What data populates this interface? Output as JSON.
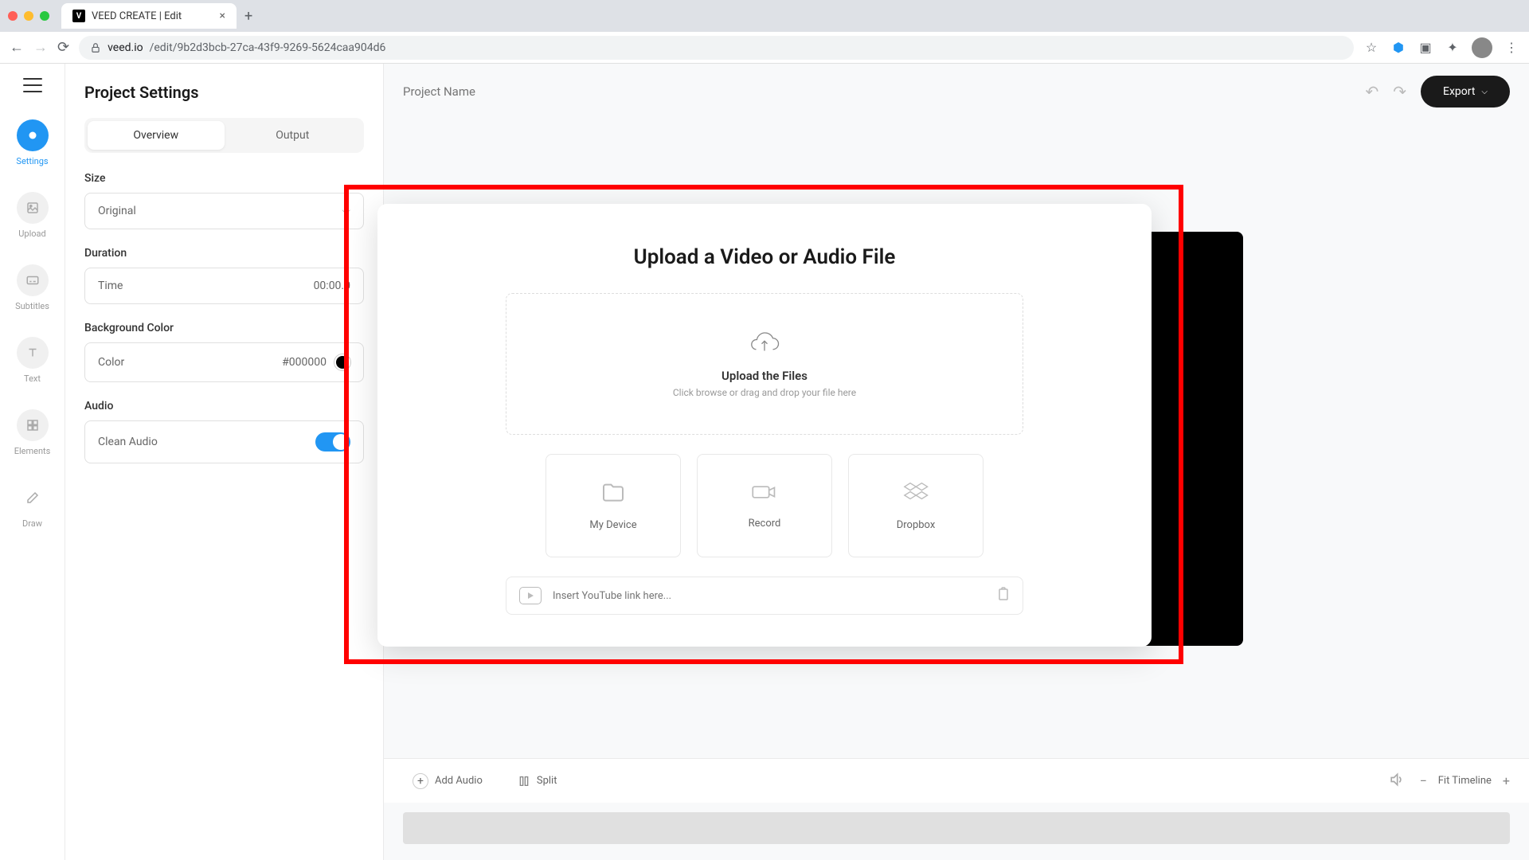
{
  "browser": {
    "tab_title": "VEED CREATE | Edit",
    "tab_favicon": "V",
    "url_domain": "veed.io",
    "url_path": "/edit/9b2d3bcb-27ca-43f9-9269-5624caa904d6"
  },
  "nav": {
    "items": [
      {
        "id": "settings",
        "label": "Settings",
        "active": true
      },
      {
        "id": "upload",
        "label": "Upload",
        "active": false
      },
      {
        "id": "subtitles",
        "label": "Subtitles",
        "active": false
      },
      {
        "id": "text",
        "label": "Text",
        "active": false
      },
      {
        "id": "elements",
        "label": "Elements",
        "active": false
      },
      {
        "id": "draw",
        "label": "Draw",
        "active": false
      }
    ]
  },
  "settings": {
    "title": "Project Settings",
    "tabs": {
      "overview": "Overview",
      "output": "Output"
    },
    "size": {
      "label": "Size",
      "value": "Original"
    },
    "duration": {
      "label": "Duration",
      "field_label": "Time",
      "value": "00:00.0"
    },
    "bg": {
      "label": "Background Color",
      "field_label": "Color",
      "value": "#000000"
    },
    "audio": {
      "label": "Audio",
      "field_label": "Clean Audio",
      "enabled": true
    }
  },
  "topbar": {
    "project_name_placeholder": "Project Name",
    "export_label": "Export"
  },
  "modal": {
    "title": "Upload a Video or Audio File",
    "dropzone": {
      "title": "Upload the Files",
      "subtitle": "Click browse or drag and\ndrop your file here"
    },
    "sources": {
      "device": "My Device",
      "record": "Record",
      "dropbox": "Dropbox"
    },
    "youtube_placeholder": "Insert YouTube link here..."
  },
  "timeline": {
    "add_audio": "Add Audio",
    "split": "Split",
    "fit": "Fit Timeline"
  }
}
